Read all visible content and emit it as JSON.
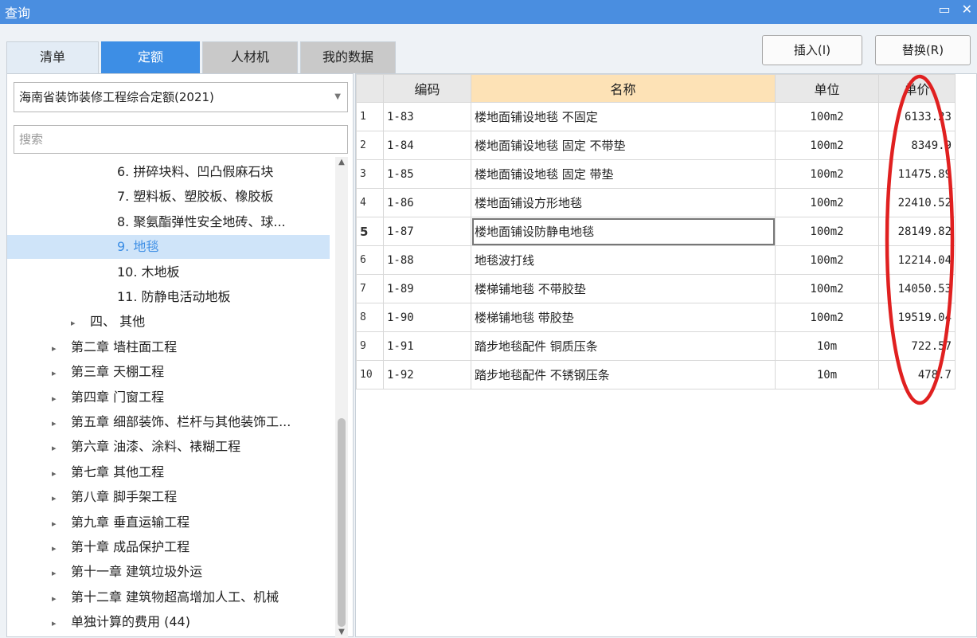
{
  "window": {
    "title": "查询",
    "restore_icon": "restore-icon",
    "close_icon": "close-icon"
  },
  "tabs": [
    "清单",
    "定额",
    "人材机",
    "我的数据"
  ],
  "active_tab": "定额",
  "buttons": {
    "insert": "插入(I)",
    "replace": "替换(R)"
  },
  "quota_select": {
    "value": "海南省装饰装修工程综合定额(2021)"
  },
  "search": {
    "placeholder": "搜索"
  },
  "tree": [
    {
      "label": "6. 拼碎块料、凹凸假麻石块",
      "level": 2
    },
    {
      "label": "7. 塑料板、塑胶板、橡胶板",
      "level": 2
    },
    {
      "label": "8. 聚氨酯弹性安全地砖、球...",
      "level": 2
    },
    {
      "label": "9. 地毯",
      "level": 2,
      "selected": true
    },
    {
      "label": "10. 木地板",
      "level": 2
    },
    {
      "label": "11. 防静电活动地板",
      "level": 2
    },
    {
      "label": "四、 其他",
      "level": 1,
      "expandable": true
    },
    {
      "label": "第二章 墙柱面工程",
      "level": 0,
      "expandable": true
    },
    {
      "label": "第三章 天棚工程",
      "level": 0,
      "expandable": true
    },
    {
      "label": "第四章 门窗工程",
      "level": 0,
      "expandable": true
    },
    {
      "label": "第五章 细部装饰、栏杆与其他装饰工...",
      "level": 0,
      "expandable": true
    },
    {
      "label": "第六章 油漆、涂料、裱糊工程",
      "level": 0,
      "expandable": true
    },
    {
      "label": "第七章 其他工程",
      "level": 0,
      "expandable": true
    },
    {
      "label": "第八章 脚手架工程",
      "level": 0,
      "expandable": true
    },
    {
      "label": "第九章 垂直运输工程",
      "level": 0,
      "expandable": true
    },
    {
      "label": "第十章 成品保护工程",
      "level": 0,
      "expandable": true
    },
    {
      "label": "第十一章 建筑垃圾外运",
      "level": 0,
      "expandable": true
    },
    {
      "label": "第十二章 建筑物超高增加人工、机械",
      "level": 0,
      "expandable": true
    },
    {
      "label": "单独计算的费用 (44)",
      "level": 0,
      "expandable": true
    }
  ],
  "table": {
    "columns": [
      "编码",
      "名称",
      "单位",
      "单价"
    ],
    "current_row": 5,
    "rows": [
      {
        "no": "1",
        "code": "1-83",
        "name": "楼地面铺设地毯 不固定",
        "unit": "100m2",
        "price": "6133.23"
      },
      {
        "no": "2",
        "code": "1-84",
        "name": "楼地面铺设地毯 固定 不带垫",
        "unit": "100m2",
        "price": "8349.9"
      },
      {
        "no": "3",
        "code": "1-85",
        "name": "楼地面铺设地毯 固定 带垫",
        "unit": "100m2",
        "price": "11475.89"
      },
      {
        "no": "4",
        "code": "1-86",
        "name": "楼地面铺设方形地毯",
        "unit": "100m2",
        "price": "22410.52"
      },
      {
        "no": "5",
        "code": "1-87",
        "name": "楼地面铺设防静电地毯",
        "unit": "100m2",
        "price": "28149.82"
      },
      {
        "no": "6",
        "code": "1-88",
        "name": "地毯波打线",
        "unit": "100m2",
        "price": "12214.04"
      },
      {
        "no": "7",
        "code": "1-89",
        "name": "楼梯铺地毯 不带胶垫",
        "unit": "100m2",
        "price": "14050.53"
      },
      {
        "no": "8",
        "code": "1-90",
        "name": "楼梯铺地毯 带胶垫",
        "unit": "100m2",
        "price": "19519.04"
      },
      {
        "no": "9",
        "code": "1-91",
        "name": "踏步地毯配件 铜质压条",
        "unit": "10m",
        "price": "722.57"
      },
      {
        "no": "10",
        "code": "1-92",
        "name": "踏步地毯配件 不锈钢压条",
        "unit": "10m",
        "price": "478.7"
      }
    ]
  },
  "annotation": {
    "shape": "ellipse",
    "color": "#e02020"
  },
  "colors": {
    "titlebar": "#4a8ee0",
    "active_tab": "#3d8ee5",
    "selected_node": "#cfe4f9",
    "name_header": "#fde2b6"
  }
}
